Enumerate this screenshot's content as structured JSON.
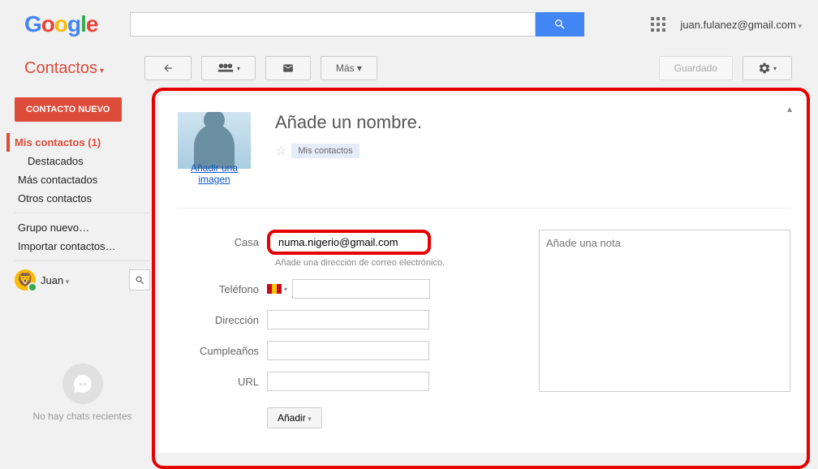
{
  "header": {
    "user_email": "juan.fulanez@gmail.com",
    "search_button_aria": "Buscar"
  },
  "toolbar": {
    "title": "Contactos",
    "more_label": "Más ▾",
    "saved_label": "Guardado"
  },
  "sidebar": {
    "new_contact_label": "CONTACTO NUEVO",
    "items": [
      {
        "label": "Mis contactos (1)",
        "active": true
      },
      {
        "label": "Destacados",
        "sub": true
      },
      {
        "label": "Más contactados"
      },
      {
        "label": "Otros contactos"
      },
      {
        "label": "Grupo nuevo…"
      },
      {
        "label": "Importar contactos…"
      }
    ],
    "profile_name": "Juan",
    "no_chats_label": "No hay chats recientes"
  },
  "card": {
    "add_image_label": "Añadir una imagen",
    "name_placeholder": "Añade un nombre.",
    "group_tag": "Mis contactos",
    "fields": {
      "email_label": "Casa",
      "email_value": "numa.nigerio@gmail.com",
      "email_hint": "Añade una dirección de correo electrónico.",
      "phone_label": "Teléfono",
      "address_label": "Dirección",
      "birthday_label": "Cumpleaños",
      "url_label": "URL",
      "add_button": "Añadir"
    },
    "note_placeholder": "Añade una nota"
  }
}
